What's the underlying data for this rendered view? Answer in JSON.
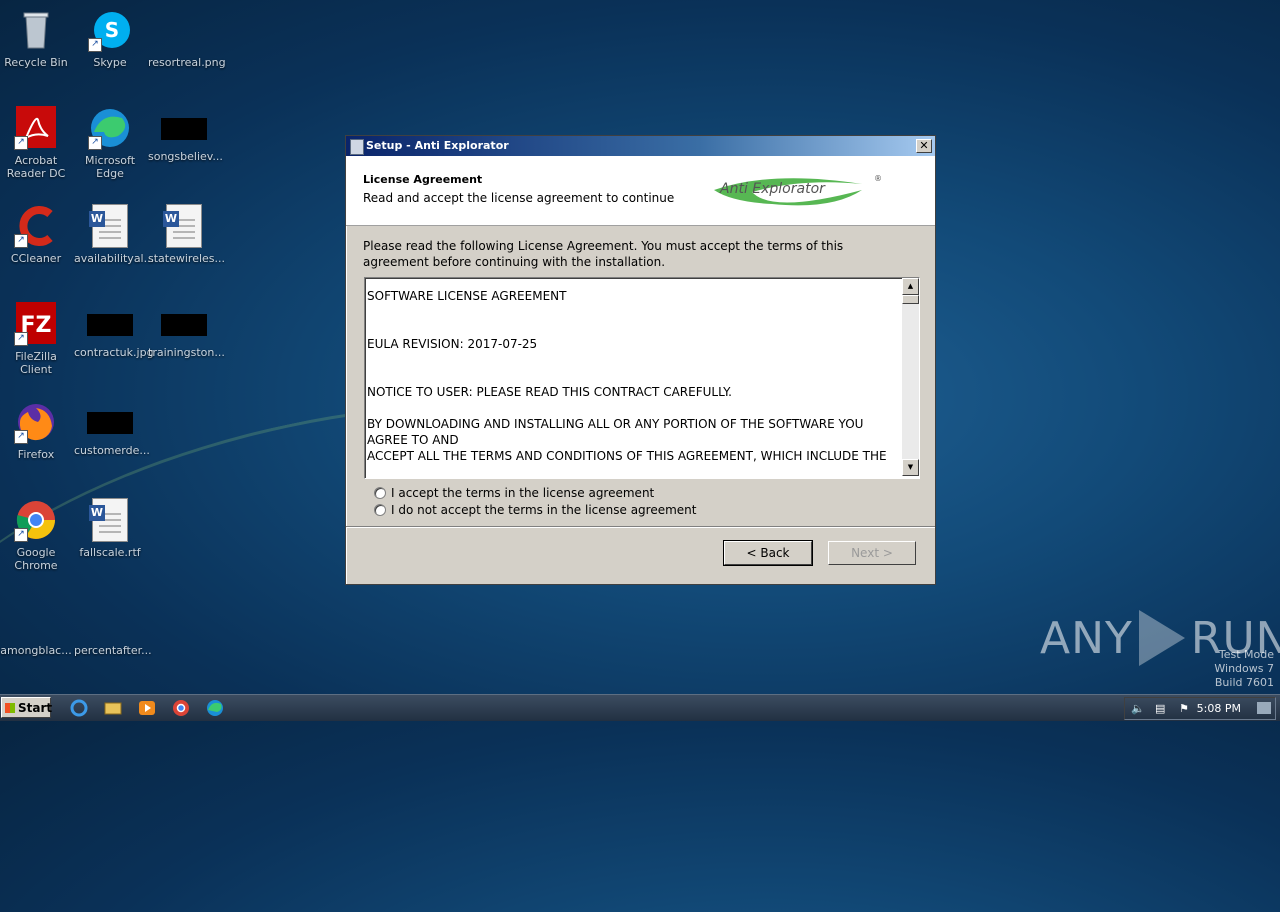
{
  "desktop": {
    "icons": [
      {
        "label": "Recycle Bin"
      },
      {
        "label": "Skype"
      },
      {
        "label": "resortreal.png"
      },
      {
        "label": "Acrobat Reader DC"
      },
      {
        "label": "Microsoft Edge"
      },
      {
        "label": "songsbeliev..."
      },
      {
        "label": "CCleaner"
      },
      {
        "label": "availabilityal..."
      },
      {
        "label": "statewireles..."
      },
      {
        "label": "FileZilla Client"
      },
      {
        "label": "contractuk.jpg"
      },
      {
        "label": "trainingston..."
      },
      {
        "label": "Firefox"
      },
      {
        "label": "customerde..."
      },
      {
        "label": "Google Chrome"
      },
      {
        "label": "fallscale.rtf"
      },
      {
        "label": "amongblac..."
      },
      {
        "label": "percentafter..."
      }
    ]
  },
  "dialog": {
    "title": "Setup - Anti Explorator",
    "close_glyph": "✕",
    "header_title": "License Agreement",
    "header_subtitle": "Read and accept the license agreement to continue",
    "logo_text": "Anti Explorator",
    "logo_mark": "®",
    "intro": "Please read the following License Agreement. You must accept the terms of this agreement before continuing with the installation.",
    "eula_lines": [
      "SOFTWARE LICENSE AGREEMENT",
      "EULA REVISION: 2017-07-25",
      "NOTICE TO USER: PLEASE READ THIS CONTRACT CAREFULLY.",
      "BY DOWNLOADING AND INSTALLING ALL OR ANY PORTION OF THE SOFTWARE YOU AGREE TO AND",
      "ACCEPT ALL THE TERMS AND CONDITIONS OF THIS AGREEMENT, WHICH INCLUDE THE"
    ],
    "radio_accept": "I accept the terms in the license agreement",
    "radio_decline": "I do not accept the terms in the license agreement",
    "back_label": "< Back",
    "next_label": "Next >"
  },
  "watermark": {
    "brand_left": "ANY",
    "brand_right": "RUN",
    "test_mode": "Test Mode",
    "os": "Windows 7",
    "build": "Build 7601"
  },
  "taskbar": {
    "start_label": "Start",
    "clock": "5:08 PM"
  },
  "colors": {
    "titlebar_start": "#0a246a",
    "titlebar_end": "#a6caf0",
    "logo_green": "#3aaa35"
  }
}
